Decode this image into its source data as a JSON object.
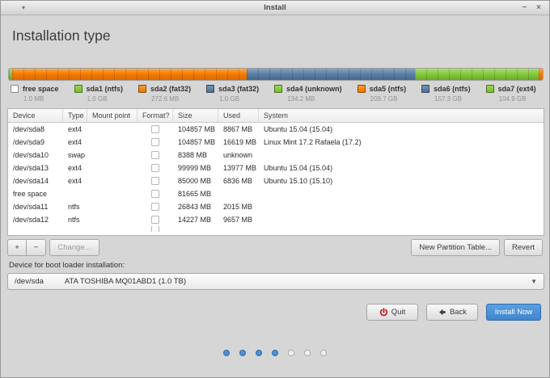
{
  "window": {
    "title": "Install",
    "menu_arrow": "▾",
    "minimize_glyph": "−",
    "close_glyph": "×"
  },
  "page": {
    "heading": "Installation type"
  },
  "colors": {
    "orange": "#f57900",
    "blue": "#5b80a5",
    "green": "#84c93d",
    "free_space": "#ffffff",
    "accent_button": "#4a90dd"
  },
  "disk_bar": {
    "segments": [
      {
        "color": "green",
        "width_pct": 0.6
      },
      {
        "color": "orange",
        "width_pct": 44.0
      },
      {
        "color": "blue",
        "width_pct": 31.5
      },
      {
        "color": "green",
        "width_pct": 23.1
      },
      {
        "color": "orange",
        "width_pct": 0.8
      }
    ]
  },
  "legend": {
    "items": [
      {
        "label": "free space",
        "size": "1.0 MB",
        "color": "free"
      },
      {
        "label": "sda1 (ntfs)",
        "size": "1.0 GB",
        "color": "green"
      },
      {
        "label": "sda2 (fat32)",
        "size": "272.6 MB",
        "color": "orange"
      },
      {
        "label": "sda3 (fat32)",
        "size": "1.0 GB",
        "color": "blue"
      },
      {
        "label": "sda4 (unknown)",
        "size": "134.2 MB",
        "color": "green"
      },
      {
        "label": "sda5 (ntfs)",
        "size": "209.7 GB",
        "color": "orange"
      },
      {
        "label": "sda6 (ntfs)",
        "size": "157.3 GB",
        "color": "blue"
      },
      {
        "label": "sda7 (ext4)",
        "size": "104.9 GB",
        "color": "green"
      }
    ]
  },
  "table": {
    "columns": [
      "Device",
      "Type",
      "Mount point",
      "Format?",
      "Size",
      "Used",
      "System"
    ],
    "rows": [
      {
        "device": "/dev/sda8",
        "type": "ext4",
        "mount_point": "",
        "format_checked": false,
        "size": "104857 MB",
        "used": "8867 MB",
        "system": "Ubuntu 15.04 (15.04)"
      },
      {
        "device": "/dev/sda9",
        "type": "ext4",
        "mount_point": "",
        "format_checked": false,
        "size": "104857 MB",
        "used": "16619 MB",
        "system": "Linux Mint 17.2 Rafaela (17.2)"
      },
      {
        "device": "/dev/sda10",
        "type": "swap",
        "mount_point": "",
        "format_checked": false,
        "size": "8388 MB",
        "used": "unknown",
        "system": ""
      },
      {
        "device": "/dev/sda13",
        "type": "ext4",
        "mount_point": "",
        "format_checked": false,
        "size": "99999 MB",
        "used": "13977 MB",
        "system": "Ubuntu 15.04 (15.04)"
      },
      {
        "device": "/dev/sda14",
        "type": "ext4",
        "mount_point": "",
        "format_checked": false,
        "size": "85000 MB",
        "used": "6836 MB",
        "system": "Ubuntu 15.10 (15.10)"
      },
      {
        "device": "free space",
        "type": "",
        "mount_point": "",
        "format_checked": false,
        "size": "81665 MB",
        "used": "",
        "system": ""
      },
      {
        "device": "/dev/sda11",
        "type": "ntfs",
        "mount_point": "",
        "format_checked": false,
        "size": "26843 MB",
        "used": "2015 MB",
        "system": ""
      },
      {
        "device": "/dev/sda12",
        "type": "ntfs",
        "mount_point": "",
        "format_checked": false,
        "size": "14227 MB",
        "used": "9657 MB",
        "system": ""
      }
    ],
    "has_partial_row": true
  },
  "partition_actions": {
    "add_label": "+",
    "remove_label": "−",
    "change_label": "Change...",
    "new_partition_table_label": "New Partition Table...",
    "revert_label": "Revert"
  },
  "boot_loader": {
    "label": "Device for boot loader installation:",
    "selected_device": "/dev/sda",
    "device_description": "ATA TOSHIBA MQ01ABD1 (1.0 TB)"
  },
  "footer": {
    "quit_label": "Quit",
    "back_label": "Back",
    "install_now_label": "Install Now"
  },
  "progress_dots": {
    "total": 7,
    "active": 4
  }
}
